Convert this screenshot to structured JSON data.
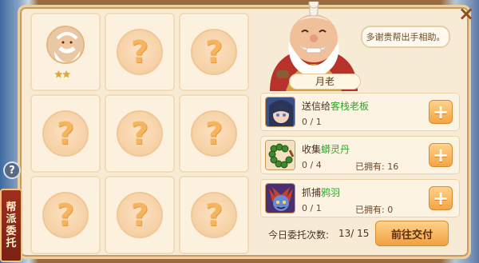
{
  "npc": {
    "name": "月老",
    "speech": "多谢贵帮出手相助。"
  },
  "grid": {
    "cells": [
      {
        "state": "filled",
        "stars": "★★"
      },
      {
        "state": "unknown",
        "symbol": "?"
      },
      {
        "state": "unknown",
        "symbol": "?"
      },
      {
        "state": "unknown",
        "symbol": "?"
      },
      {
        "state": "unknown",
        "symbol": "?"
      },
      {
        "state": "unknown",
        "symbol": "?"
      },
      {
        "state": "unknown",
        "symbol": "?"
      },
      {
        "state": "unknown",
        "symbol": "?"
      },
      {
        "state": "unknown",
        "symbol": "?"
      }
    ]
  },
  "side_tab": {
    "label_chars": [
      "帮",
      "派",
      "委",
      "托"
    ],
    "help": "?"
  },
  "tasks": [
    {
      "verb": "送信给",
      "target": "客栈老板",
      "progress": "0 / 1",
      "owned": ""
    },
    {
      "verb": "收集",
      "target": "蟒灵丹",
      "progress": "0 / 4",
      "owned": "已拥有: 16"
    },
    {
      "verb": "抓捕",
      "target": "鸦羽",
      "progress": "0 / 1",
      "owned": "已拥有: 0"
    }
  ],
  "footer": {
    "label": "今日委托次数:",
    "count": "13/ 15",
    "submit_label": "前往交付"
  },
  "close_symbol": "×",
  "add_symbol": "+",
  "colors": {
    "highlight_green": "#2fa62b",
    "accent_orange": "#f2a040"
  }
}
